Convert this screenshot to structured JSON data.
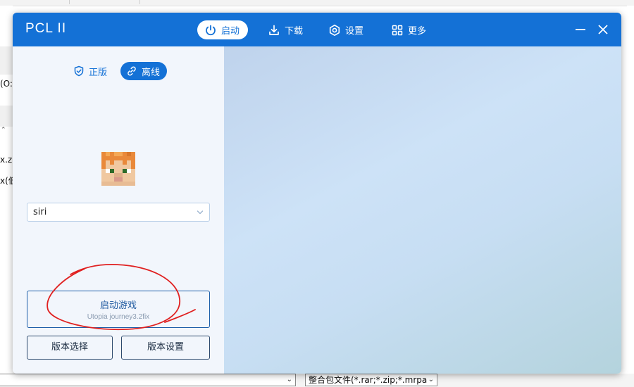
{
  "background": {
    "left_fragments": [
      "(O:",
      "x.zi",
      "x(低"
    ],
    "bottom_combo_value": "整合包文件(*.rar;*.zip;*.mrpac"
  },
  "window": {
    "title": "PCL II",
    "nav": [
      {
        "label": "启动",
        "icon": "power-icon",
        "active": true
      },
      {
        "label": "下载",
        "icon": "download-icon",
        "active": false
      },
      {
        "label": "设置",
        "icon": "settings-icon",
        "active": false
      },
      {
        "label": "更多",
        "icon": "grid-icon",
        "active": false
      }
    ]
  },
  "launch_panel": {
    "modes": [
      {
        "label": "正版",
        "icon": "shield-icon",
        "active": false
      },
      {
        "label": "离线",
        "icon": "link-icon",
        "active": true
      }
    ],
    "username": "siri",
    "launch_button": {
      "label": "启动游戏",
      "version": "Utopia journey3.2fix"
    },
    "version_select_label": "版本选择",
    "version_settings_label": "版本设置"
  },
  "colors": {
    "accent": "#1471d6",
    "panel_bg": "#f2f6fc",
    "annotation": "#e02020"
  }
}
